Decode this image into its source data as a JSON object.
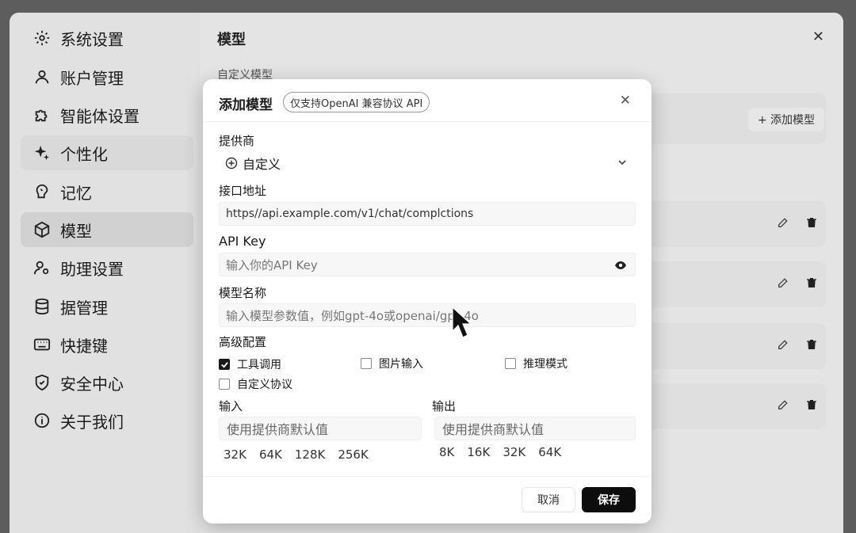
{
  "sidebar": {
    "items": [
      {
        "label": "系统设置",
        "icon": "gear-icon"
      },
      {
        "label": "账户管理",
        "icon": "user-icon"
      },
      {
        "label": "智能体设置",
        "icon": "puzzle-icon"
      },
      {
        "label": "个性化",
        "icon": "sparkle-icon"
      },
      {
        "label": "记忆",
        "icon": "brain-icon"
      },
      {
        "label": "模型",
        "icon": "cube-icon"
      },
      {
        "label": "助理设置",
        "icon": "assistant-icon"
      },
      {
        "label": "据管理",
        "icon": "database-icon"
      },
      {
        "label": "快捷键",
        "icon": "keyboard-icon"
      },
      {
        "label": "安全中心",
        "icon": "shield-icon"
      },
      {
        "label": "关于我们",
        "icon": "info-icon"
      }
    ],
    "active": "模型"
  },
  "main": {
    "title": "模型",
    "section_label": "自定义模型",
    "add_button": "+ 添加模型"
  },
  "dialog": {
    "title": "添加模型",
    "badge": "仅支持OpenAI 兼容协议 API",
    "provider": {
      "label": "提供商",
      "value": "自定义"
    },
    "endpoint": {
      "label": "接口地址",
      "value": "https//api.example.com/v1/chat/complctions"
    },
    "api_key": {
      "label": "API Key",
      "placeholder": "输入你的API Key"
    },
    "model_name": {
      "label": "模型名称",
      "placeholder": "输入模型参数值，例如gpt-4o或openai/gpt-4o"
    },
    "advanced": {
      "label": "高级配置",
      "options": [
        {
          "label": "工具调用",
          "checked": true
        },
        {
          "label": "图片输入",
          "checked": false
        },
        {
          "label": "推理模式",
          "checked": false
        },
        {
          "label": "自定义协议",
          "checked": false
        }
      ]
    },
    "input": {
      "label": "输入",
      "placeholder": "使用提供商默认值",
      "presets": [
        "32K",
        "64K",
        "128K",
        "256K"
      ]
    },
    "output": {
      "label": "输出",
      "placeholder": "使用提供商默认值",
      "presets": [
        "8K",
        "16K",
        "32K",
        "64K"
      ]
    },
    "cancel": "取消",
    "save": "保存"
  },
  "colors": {
    "primary_button": "#0d0d0d",
    "dialog_bg": "#ffffff",
    "sidebar_active": "#d6d6d6"
  }
}
